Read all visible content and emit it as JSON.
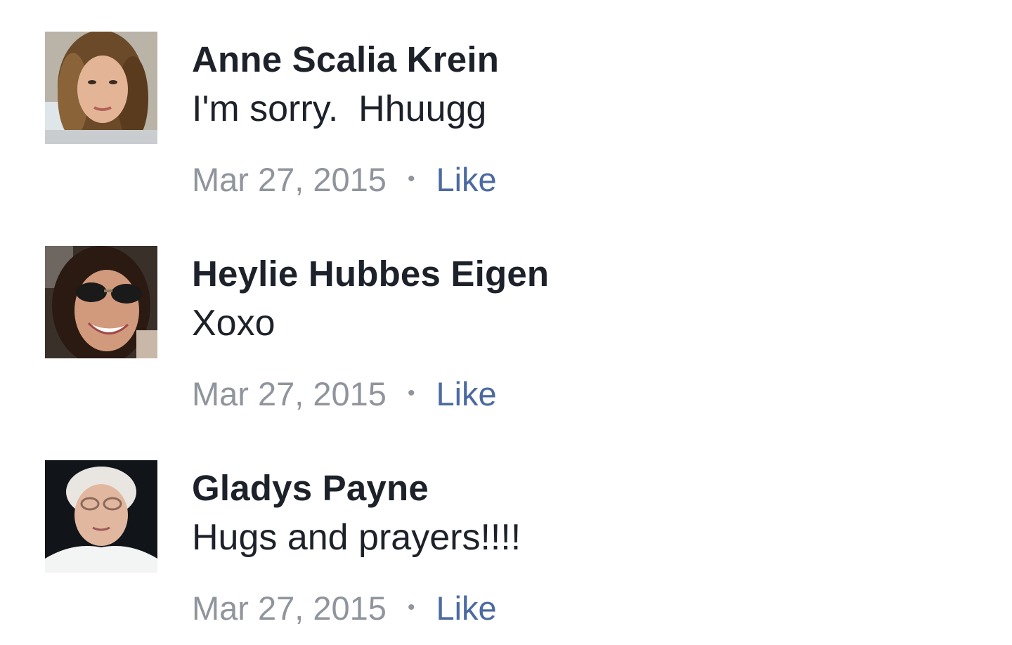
{
  "colors": {
    "author_text": "#1d2129",
    "meta_text": "#90949c",
    "like_link": "#4b6aa0",
    "background": "#ffffff"
  },
  "comments": [
    {
      "author": "Anne Scalia Krein",
      "text": "I'm sorry.  Hhuugg",
      "date": "Mar 27, 2015",
      "separator": "•",
      "like_label": "Like",
      "avatar_icon": "profile-photo-woman-curly-hair"
    },
    {
      "author": "Heylie Hubbes Eigen",
      "text": "Xoxo",
      "date": "Mar 27, 2015",
      "separator": "•",
      "like_label": "Like",
      "avatar_icon": "profile-photo-woman-sunglasses"
    },
    {
      "author": "Gladys Payne",
      "text": "Hugs and prayers!!!!",
      "date": "Mar 27, 2015",
      "separator": "•",
      "like_label": "Like",
      "avatar_icon": "profile-photo-elderly-woman-glasses"
    }
  ]
}
